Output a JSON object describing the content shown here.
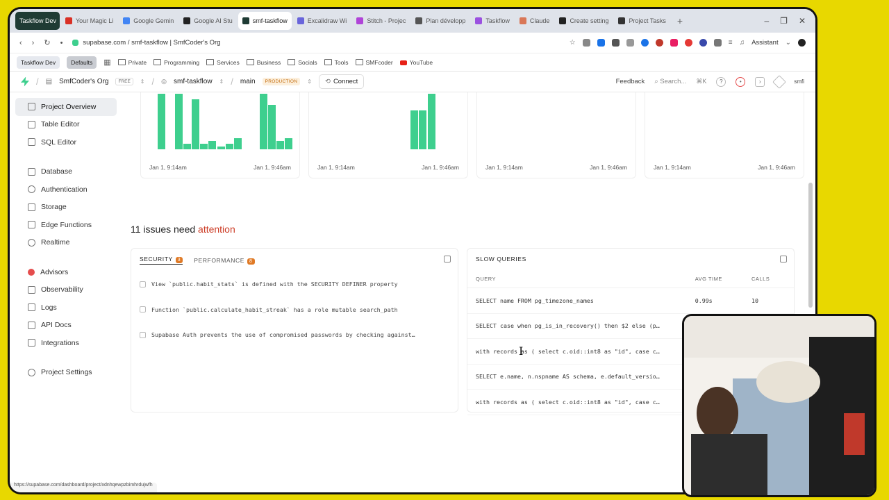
{
  "browser": {
    "tabs": [
      {
        "label": "Taskflow Dev",
        "color": "#1f3b34",
        "first": true
      },
      {
        "label": "Your Magic Li",
        "color": "#d93025"
      },
      {
        "label": "Google Gemin",
        "color": "#4285f4"
      },
      {
        "label": "Google AI Stu",
        "color": "#222222"
      },
      {
        "label": "smf-taskflow",
        "color": "#1f3b34",
        "active": true
      },
      {
        "label": "Excalidraw Wi",
        "color": "#6965db"
      },
      {
        "label": "Stitch - Projec",
        "color": "#b044d8"
      },
      {
        "label": "Plan développ",
        "color": "#555555"
      },
      {
        "label": "Taskflow",
        "color": "#9b51e0"
      },
      {
        "label": "Claude",
        "color": "#d97757"
      },
      {
        "label": "Create setting",
        "color": "#222222"
      },
      {
        "label": "Project Tasks",
        "color": "#333333"
      }
    ],
    "url": "supabase.com / smf-taskflow | SmfCoder's Org",
    "assistant_label": "Assistant",
    "bookmarks": [
      {
        "label": "Taskflow Dev",
        "kind": "pill"
      },
      {
        "label": "Defaults",
        "kind": "def"
      },
      {
        "label": "Private",
        "kind": "folder"
      },
      {
        "label": "Programming",
        "kind": "folder"
      },
      {
        "label": "Services",
        "kind": "folder"
      },
      {
        "label": "Business",
        "kind": "folder"
      },
      {
        "label": "Socials",
        "kind": "folder"
      },
      {
        "label": "Tools",
        "kind": "folder"
      },
      {
        "label": "SMFcoder",
        "kind": "folder"
      },
      {
        "label": "YouTube",
        "kind": "yt"
      }
    ],
    "status_url": "https://supabase.com/dashboard/project/xdnhqewpzbimhrdujwfh"
  },
  "topnav": {
    "org": "SmfCoder's Org",
    "plan": "FREE",
    "project": "smf-taskflow",
    "branch": "main",
    "env": "PRODUCTION",
    "connect": "Connect",
    "feedback": "Feedback",
    "search": "Search...",
    "shortcut": "⌘K",
    "user": "smfi"
  },
  "sidebar": {
    "groups": [
      [
        {
          "label": "Project Overview",
          "icon": "home-icon",
          "active": true
        },
        {
          "label": "Table Editor",
          "icon": "table-icon"
        },
        {
          "label": "SQL Editor",
          "icon": "terminal-icon"
        }
      ],
      [
        {
          "label": "Database",
          "icon": "database-icon"
        },
        {
          "label": "Authentication",
          "icon": "users-icon"
        },
        {
          "label": "Storage",
          "icon": "archive-icon"
        },
        {
          "label": "Edge Functions",
          "icon": "function-icon"
        },
        {
          "label": "Realtime",
          "icon": "realtime-icon"
        }
      ],
      [
        {
          "label": "Advisors",
          "icon": "lightbulb-icon",
          "alert": true
        },
        {
          "label": "Observability",
          "icon": "chart-icon"
        },
        {
          "label": "Logs",
          "icon": "list-icon"
        },
        {
          "label": "API Docs",
          "icon": "docs-icon"
        },
        {
          "label": "Integrations",
          "icon": "grid-icon"
        }
      ],
      [
        {
          "label": "Project Settings",
          "icon": "gear-icon"
        }
      ]
    ]
  },
  "usage_charts": [
    {
      "start": "Jan 1, 9:14am",
      "end": "Jan 1, 9:46am",
      "values": [
        0,
        1,
        0,
        1,
        0.1,
        0.9,
        0.1,
        0.15,
        0.05,
        0.1,
        0.2,
        0,
        0,
        1,
        0.8,
        0.15,
        0.2
      ]
    },
    {
      "start": "Jan 1, 9:14am",
      "end": "Jan 1, 9:46am",
      "values": [
        0,
        0,
        0,
        0,
        0,
        0,
        0,
        0,
        0,
        0,
        0,
        0.7,
        0.7,
        1,
        0,
        0,
        0
      ]
    },
    {
      "start": "Jan 1, 9:14am",
      "end": "Jan 1, 9:46am",
      "values": []
    },
    {
      "start": "Jan 1, 9:14am",
      "end": "Jan 1, 9:46am",
      "values": []
    }
  ],
  "issues": {
    "count_text": "11 issues need",
    "highlight": "attention",
    "security_tab": "SECURITY",
    "security_count": "3",
    "performance_tab": "PERFORMANCE",
    "performance_count": "8",
    "items": [
      "View `public.habit_stats` is defined with the SECURITY DEFINER property",
      "Function `public.calculate_habit_streak` has a role mutable search_path",
      "Supabase Auth prevents the use of compromised passwords by checking against…"
    ]
  },
  "slow_queries": {
    "title": "SLOW QUERIES",
    "headers": {
      "query": "QUERY",
      "avg": "AVG TIME",
      "calls": "CALLS"
    },
    "rows": [
      {
        "query": "SELECT name FROM pg_timezone_names",
        "avg": "0.99s",
        "calls": "10"
      },
      {
        "query": "SELECT case when pg_is_in_recovery() then $2 else (p…",
        "avg": "",
        "calls": ""
      },
      {
        "query": "with records as ( select c.oid::int8 as \"id\", case c…",
        "avg": "",
        "calls": ""
      },
      {
        "query": "SELECT e.name, n.nspname AS schema, e.default_versio…",
        "avg": "",
        "calls": ""
      },
      {
        "query": "with records as ( select c.oid::int8 as \"id\", case c…",
        "avg": "",
        "calls": ""
      }
    ]
  },
  "colors": {
    "brand": "#3ecf8e",
    "attention": "#cc3b24",
    "badge": "#e07a26"
  }
}
